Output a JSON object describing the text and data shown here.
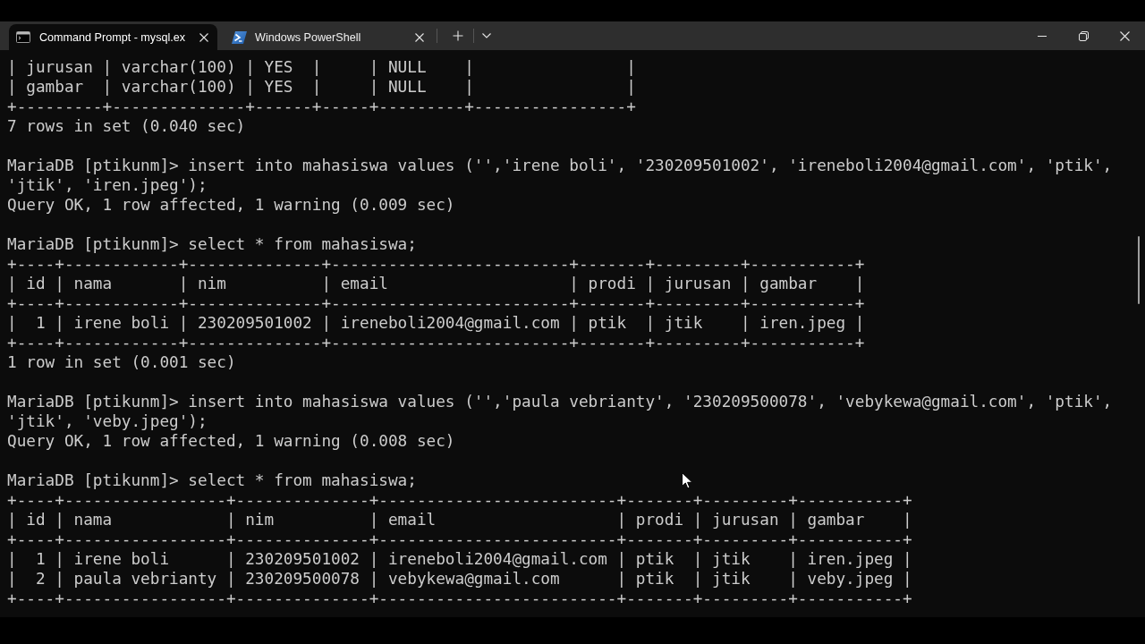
{
  "tabs": [
    {
      "kind": "cmd",
      "title": "Command Prompt - mysql.ex",
      "selected": true
    },
    {
      "kind": "powershell",
      "title": "Windows PowerShell",
      "selected": false
    }
  ],
  "terminal": {
    "entries": [
      {
        "kind": "output",
        "table": {
          "rows": [
            "| jurusan | varchar(100) | YES  |     | NULL    |                |",
            "| gambar  | varchar(100) | YES  |     | NULL    |                |"
          ],
          "bottom_border": "+---------+--------------+------+-----+---------+----------------+"
        },
        "status": "7 rows in set (0.040 sec)"
      },
      {
        "kind": "command",
        "prompt": "MariaDB [ptikunm]>",
        "command": [
          "insert into mahasiswa values ('','irene boli', '230209501002', 'ireneboli2004@gmail.com', 'ptik',",
          "'jtik', 'iren.jpeg');"
        ],
        "status": "Query OK, 1 row affected, 1 warning (0.009 sec)"
      },
      {
        "kind": "command",
        "prompt": "MariaDB [ptikunm]>",
        "command": [
          "select * from mahasiswa;"
        ],
        "table": {
          "top_border": "+----+------------+--------------+-------------------------+-------+---------+-----------+",
          "header": "| id | nama       | nim          | email                   | prodi | jurusan | gambar    |",
          "header_border": "+----+------------+--------------+-------------------------+-------+---------+-----------+",
          "rows": [
            "|  1 | irene boli | 230209501002 | ireneboli2004@gmail.com | ptik  | jtik    | iren.jpeg |"
          ],
          "bottom_border": "+----+------------+--------------+-------------------------+-------+---------+-----------+"
        },
        "status": "1 row in set (0.001 sec)"
      },
      {
        "kind": "command",
        "prompt": "MariaDB [ptikunm]>",
        "command": [
          "insert into mahasiswa values ('','paula vebrianty', '230209500078', 'vebykewa@gmail.com', 'ptik',",
          "'jtik', 'veby.jpeg');"
        ],
        "status": "Query OK, 1 row affected, 1 warning (0.008 sec)"
      },
      {
        "kind": "command",
        "prompt": "MariaDB [ptikunm]>",
        "command": [
          "select * from mahasiswa;"
        ],
        "table": {
          "top_border": "+----+-----------------+--------------+-------------------------+-------+---------+-----------+",
          "header": "| id | nama            | nim          | email                   | prodi | jurusan | gambar    |",
          "header_border": "+----+-----------------+--------------+-------------------------+-------+---------+-----------+",
          "rows": [
            "|  1 | irene boli      | 230209501002 | ireneboli2004@gmail.com | ptik  | jtik    | iren.jpeg |",
            "|  2 | paula vebrianty | 230209500078 | vebykewa@gmail.com      | ptik  | jtik    | veby.jpeg |"
          ],
          "bottom_border": "+----+-----------------+--------------+-------------------------+-------+---------+-----------+"
        }
      }
    ]
  }
}
